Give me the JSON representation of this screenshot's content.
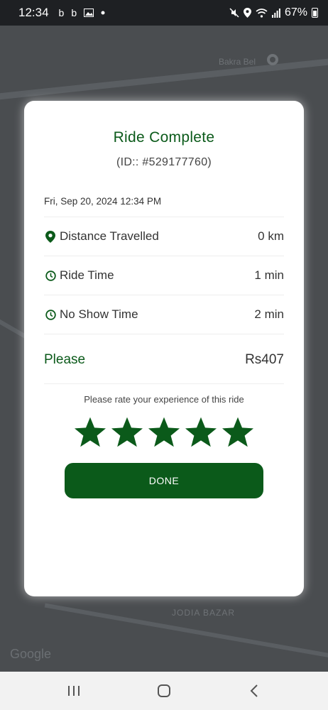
{
  "status_bar": {
    "time": "12:34",
    "notif_1": "b",
    "notif_2": "b",
    "battery_text": "67%"
  },
  "map": {
    "labels": [
      "Bakra Bel",
      "JODIA BAZAR",
      "Google"
    ]
  },
  "modal": {
    "title": "Ride Complete",
    "ride_id": "(ID:: #529177760)",
    "date": "Fri, Sep 20, 2024 12:34 PM",
    "rows": [
      {
        "label": "Distance Travelled",
        "value": "0 km",
        "icon": "location-pin-icon"
      },
      {
        "label": "Ride Time",
        "value": "1 min",
        "icon": "clock-icon"
      },
      {
        "label": "No Show Time",
        "value": "2 min",
        "icon": "clock-icon"
      }
    ],
    "fare_label": "Please",
    "fare_amount": "Rs407",
    "rate_prompt": "Please rate your experience of this ride",
    "rating": 5,
    "rating_max": 5,
    "done_label": "DONE"
  },
  "colors": {
    "brand_green": "#0b5a1a",
    "star_green": "#0b5a1a"
  }
}
